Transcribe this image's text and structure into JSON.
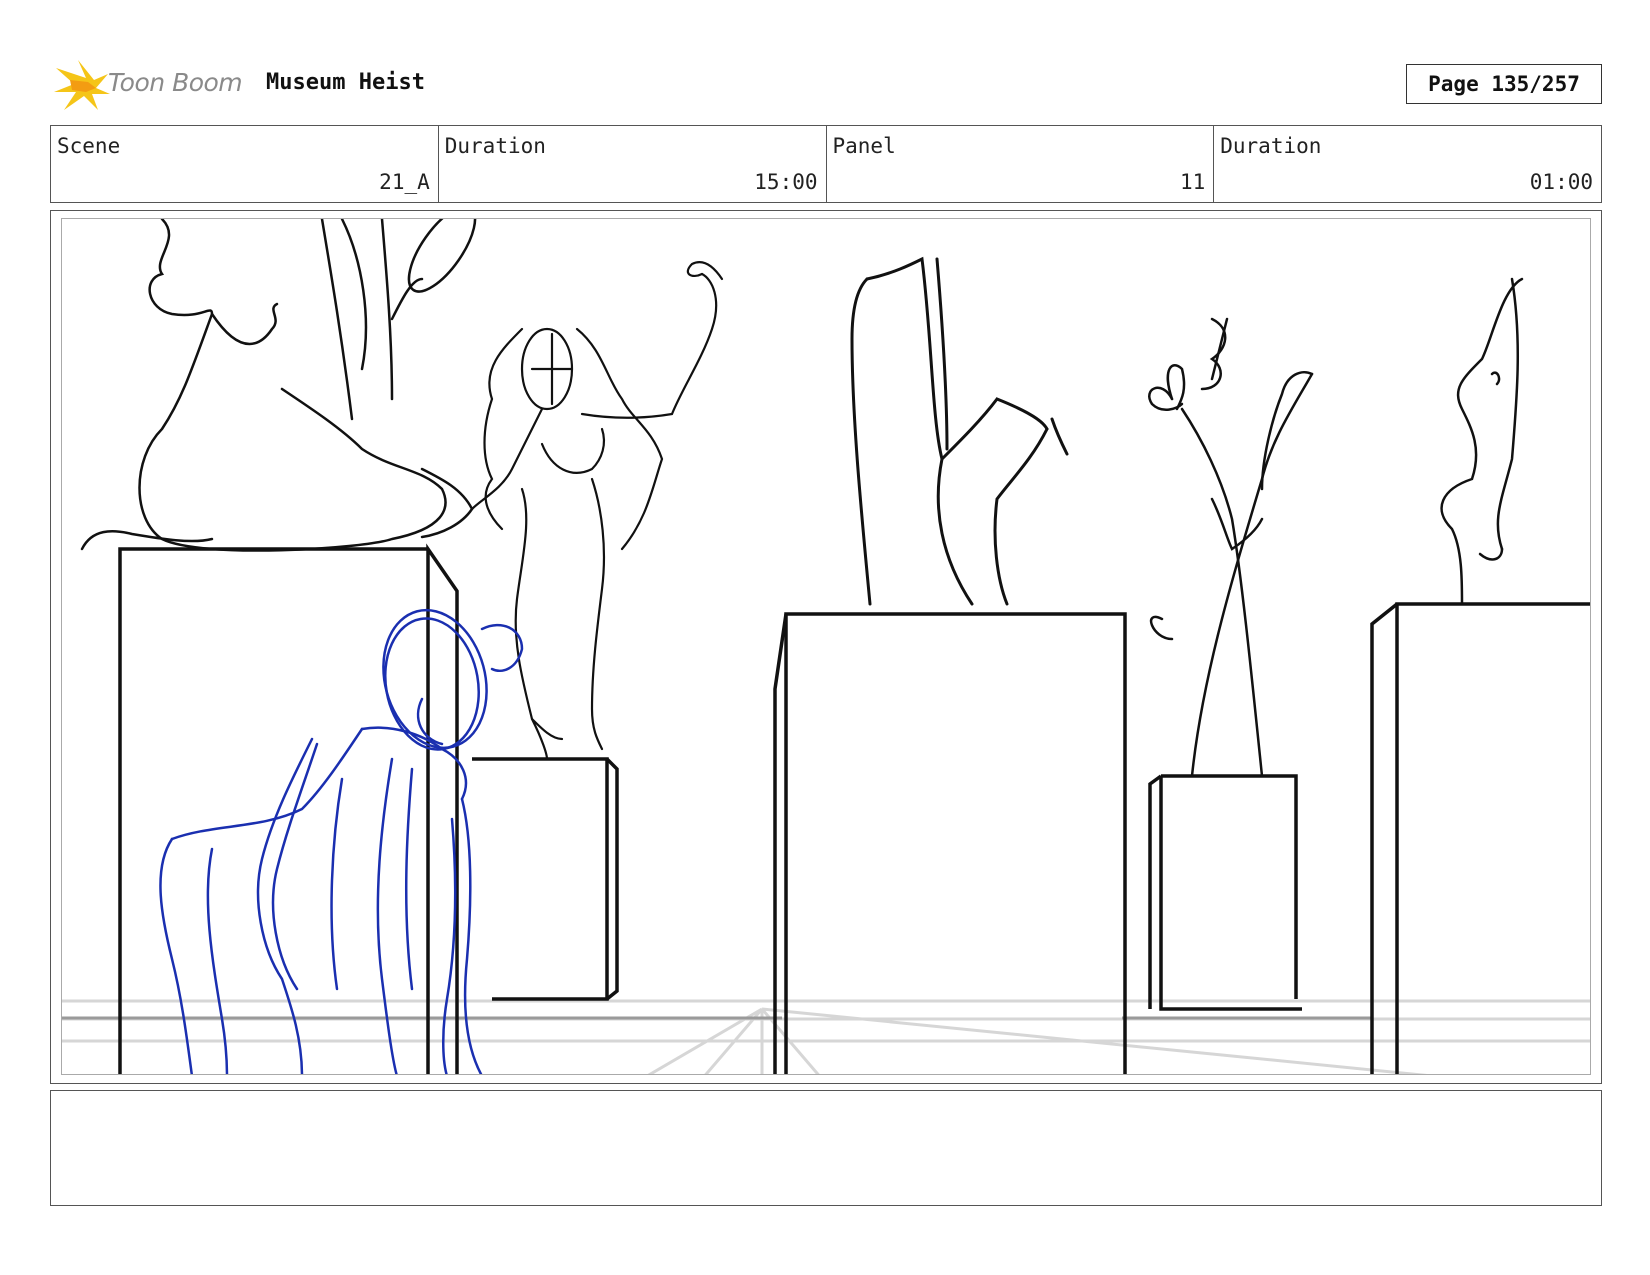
{
  "header": {
    "logo_text": "Toon Boom",
    "project_title": "Museum Heist",
    "page_label": "Page 135/257"
  },
  "info": {
    "scene_label": "Scene",
    "scene_value": "21_A",
    "scene_duration_label": "Duration",
    "scene_duration_value": "15:00",
    "panel_label": "Panel",
    "panel_value": "11",
    "panel_duration_label": "Duration",
    "panel_duration_value": "01:00"
  },
  "colors": {
    "sketch_black": "#111111",
    "sketch_blue": "#1a2fb0",
    "logo_yellow": "#f5c518",
    "guide_gray": "#d6d6d6"
  },
  "notes": {
    "text": ""
  }
}
